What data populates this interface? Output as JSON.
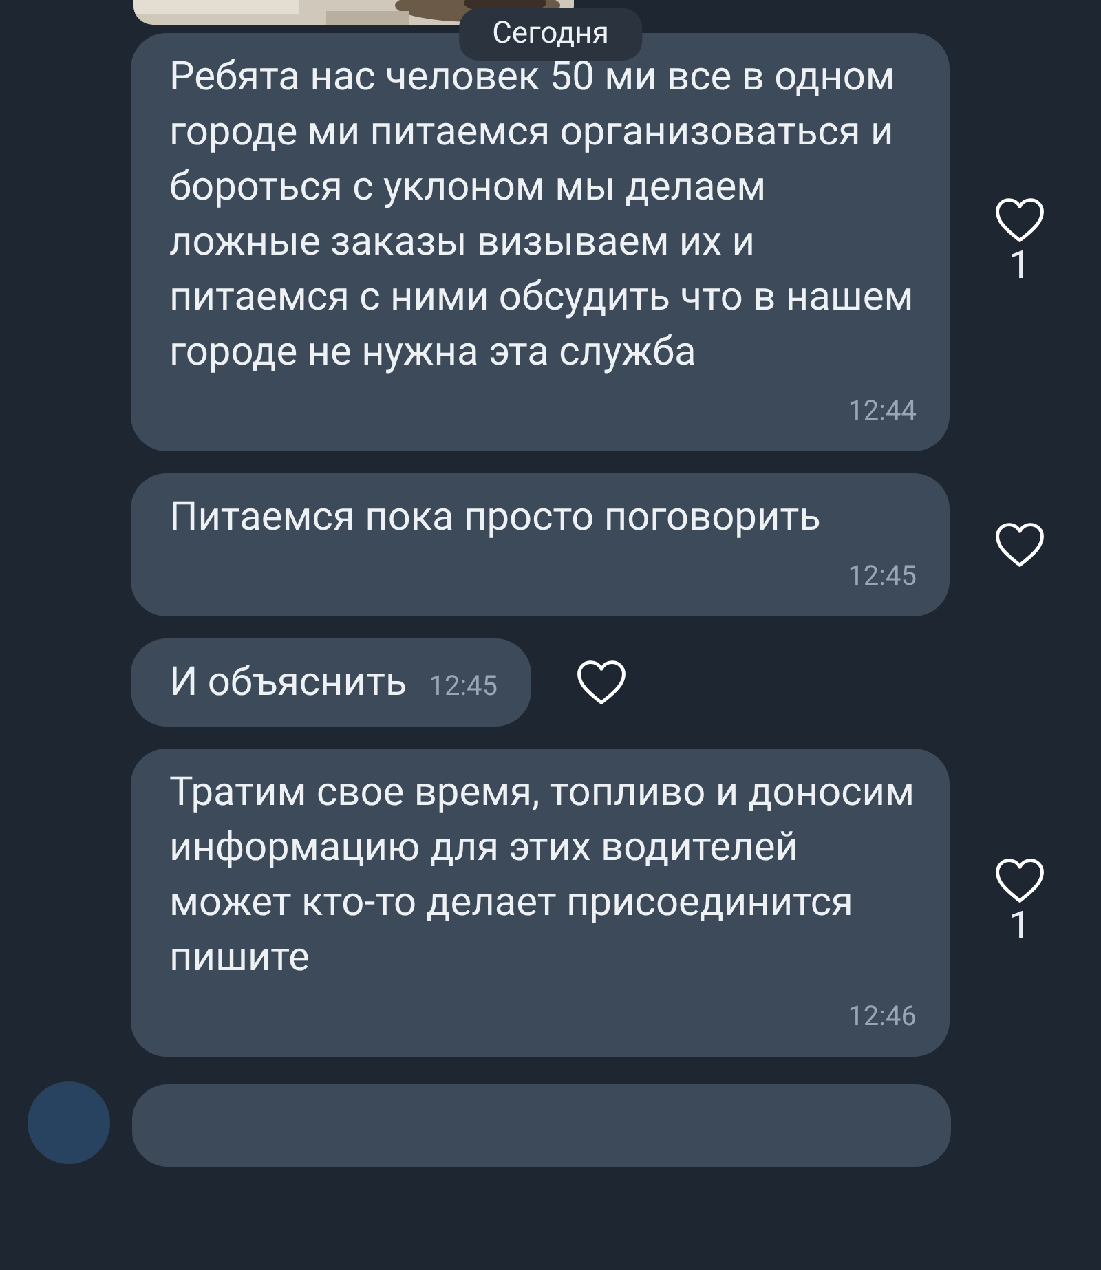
{
  "date_chip": "Сегодня",
  "messages": [
    {
      "kind": "block",
      "text": "Ребята нас человек 50 ми все в одном городе ми питаемся организоваться и бороться с уклоном мы делаем ложные заказы визываем их и питаемся с ними обсудить что в нашем городе не нужна эта служба",
      "time": "12:44",
      "likes": "1"
    },
    {
      "kind": "block",
      "text": "Питаемся пока просто поговорить",
      "time": "12:45"
    },
    {
      "kind": "inline",
      "text": "И объяснить",
      "time": "12:45"
    },
    {
      "kind": "block",
      "text": "Тратим свое время, топливо и доносим информацию для этих водителей может кто-то делает присоединится пишите",
      "time": "12:46",
      "likes": "1"
    }
  ]
}
